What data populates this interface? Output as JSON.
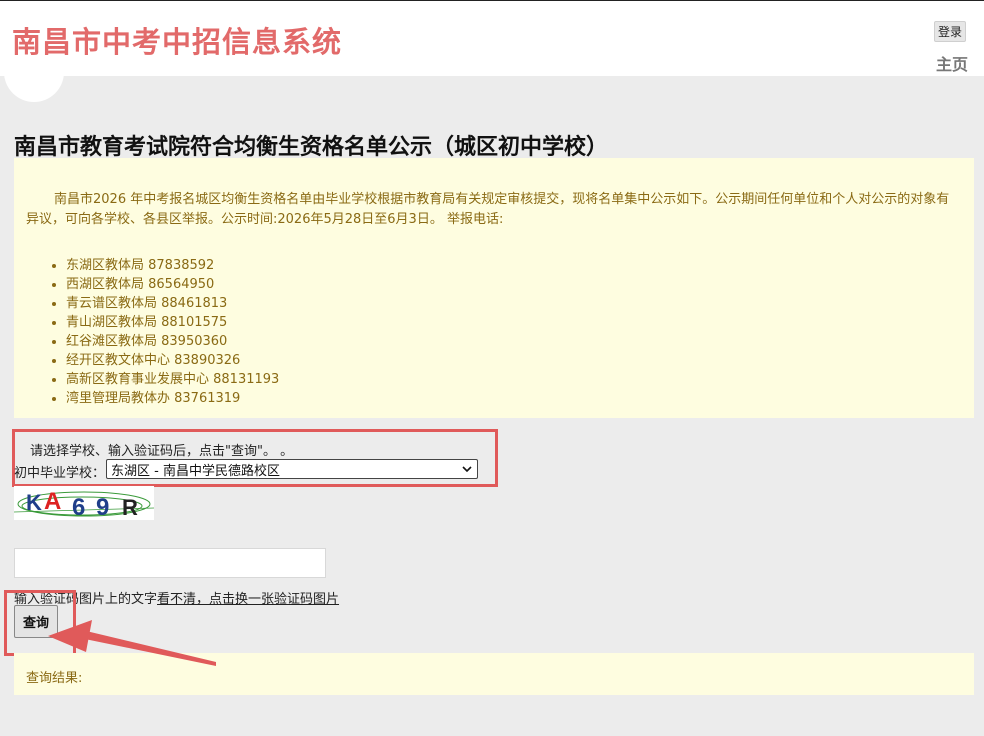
{
  "header": {
    "site_title": "南昌市中考中招信息系统",
    "login_label": "登录",
    "home_label": "主页"
  },
  "main": {
    "heading": "南昌市教育考试院符合均衡生资格名单公示（城区初中学校）",
    "notice": "南昌市2026 年中考报名城区均衡生资格名单由毕业学校根据市教育局有关规定审核提交，现将名单集中公示如下。公示期间任何单位和个人对公示的对象有异议，可向各学校、各县区举报。公示时间:2026年5月28日至6月3日。      举报电话:",
    "phones": [
      "东湖区教体局 87838592",
      "西湖区教体局 86564950",
      "青云谱区教体局 88461813",
      "青山湖区教体局 88101575",
      "红谷滩区教体局 83950360",
      "经开区教文体中心 83890326",
      "高新区教育事业发展中心 88131193",
      "湾里管理局教体办 83761319"
    ]
  },
  "query": {
    "instruction": "请选择学校、输入验证码后，点击\"查询\"。 。",
    "school_label": "初中毕业学校：",
    "school_selected": "东湖区 - 南昌中学民德路校区",
    "captcha_text": "KA69R",
    "captcha_input_value": "",
    "hint_prefix": "输入验证码图片上的文字",
    "hint_link": "看不清，点击换一张验证码图片",
    "button_label": "查询",
    "result_label": "查询结果:"
  },
  "colors": {
    "title": "#e26a6a",
    "notice_bg": "#fefde0",
    "notice_text": "#8a6a14",
    "highlight": "#e05a5a"
  }
}
